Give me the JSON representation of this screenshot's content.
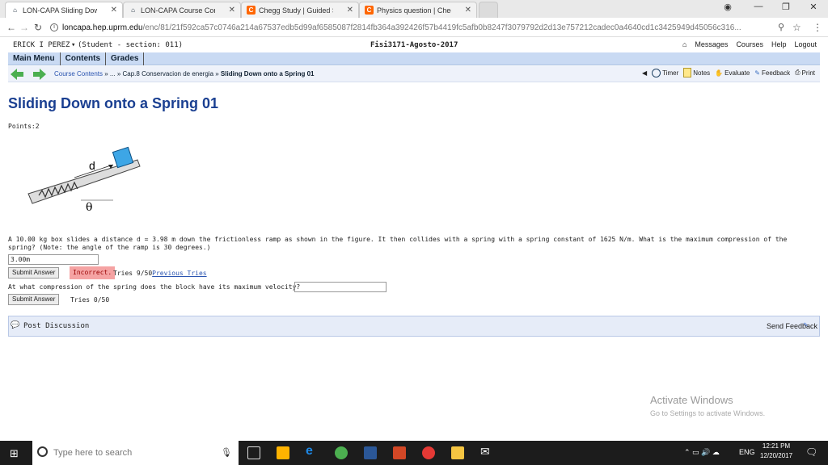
{
  "tabs": [
    {
      "title": "LON-CAPA Sliding Down",
      "icon": "loncapa-icon",
      "active": true
    },
    {
      "title": "LON-CAPA Course Conte",
      "icon": "loncapa-icon",
      "active": false
    },
    {
      "title": "Chegg Study | Guided So",
      "icon": "chegg-icon",
      "active": false
    },
    {
      "title": "Physics question | Chegg",
      "icon": "chegg-icon",
      "active": false
    }
  ],
  "address": {
    "host": "loncapa.hep.uprm.edu",
    "path": "/enc/81/21f592ca57c0746a214a67537edb5d99af6585087f2814fb364a392426f57b4419fc5afb0b8247f3079792d2d13e757212cadec0a4640cd1c3425949d45056c316..."
  },
  "user": {
    "name": "ERICK I PEREZ",
    "role": "(Student - section: 011)",
    "course": "Fisi3171-Agosto-2017"
  },
  "topnav": [
    "Messages",
    "Courses",
    "Help",
    "Logout"
  ],
  "menu": [
    "Main Menu",
    "Contents",
    "Grades"
  ],
  "breadcrumb": {
    "a": "Course Contents",
    "sep1": " » ... » ",
    "b": "Cap.8 Conservacion de energia",
    "sep2": " » ",
    "c": "Sliding Down onto a Spring 01"
  },
  "tools": [
    "Timer",
    "Notes",
    "Evaluate",
    "Feedback",
    "Print"
  ],
  "title": "Sliding Down onto a Spring 01",
  "points": "Points:2",
  "figure": {
    "d": "d",
    "theta": "θ"
  },
  "question": "A 10.00 kg box slides a distance d = 3.98 m down the frictionless ramp as shown in the figure. It then collides with a spring with a spring constant of 1625 N/m. What is the maximum compression of the spring? (Note: the angle of the ramp is 30 degrees.)",
  "answer1": "3.00m",
  "submit": "Submit Answer",
  "incorrect": "Incorrect.",
  "tries1": "Tries 9/50",
  "previous_tries": "Previous Tries",
  "question2": "At what compression of the spring does the block have its maximum velocity?",
  "tries2": "Tries 0/50",
  "post_discussion": "Post Discussion",
  "send_feedback": "Send Feedback",
  "watermark": {
    "line1": "Activate Windows",
    "line2": "Go to Settings to activate Windows."
  },
  "taskbar": {
    "search": "Type here to search",
    "time": "12:21 PM",
    "date": "12/20/2017",
    "lang": "ENG"
  }
}
